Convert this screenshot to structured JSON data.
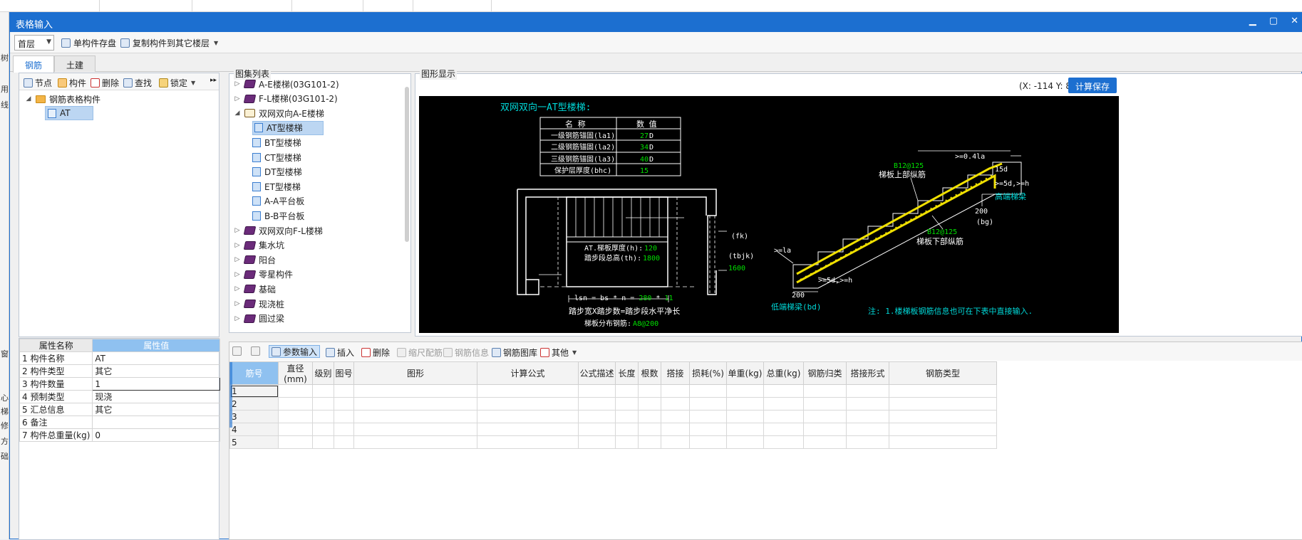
{
  "window": {
    "title": "表格输入"
  },
  "toolbar": {
    "floor": "首层",
    "save_single": "单构件存盘",
    "copy_to_floor": "复制构件到其它楼层"
  },
  "left_edge": [
    "树",
    "用",
    "线",
    "窗",
    "心",
    "梯",
    "修",
    "方",
    "础"
  ],
  "tabs": [
    {
      "label": "钢筋",
      "active": true
    },
    {
      "label": "土建",
      "active": false
    }
  ],
  "left_panel": {
    "tools": [
      "节点",
      "构件",
      "删除",
      "查找",
      "锁定"
    ],
    "tree_root": "钢筋表格构件",
    "tree_child": "AT"
  },
  "properties": {
    "header_name": "属性名称",
    "header_value": "属性值",
    "rows": [
      {
        "no": "1",
        "name": "构件名称",
        "value": "AT"
      },
      {
        "no": "2",
        "name": "构件类型",
        "value": "其它"
      },
      {
        "no": "3",
        "name": "构件数量",
        "value": "1"
      },
      {
        "no": "4",
        "name": "预制类型",
        "value": "现浇"
      },
      {
        "no": "5",
        "name": "汇总信息",
        "value": "其它"
      },
      {
        "no": "6",
        "name": "备注",
        "value": ""
      },
      {
        "no": "7",
        "name": "构件总重量(kg)",
        "value": "0"
      }
    ]
  },
  "atlas": {
    "title": "图集列表",
    "items": [
      {
        "label": "A-E楼梯(03G101-2)",
        "level": 0,
        "icon": "book-icon",
        "exp": "▷"
      },
      {
        "label": "F-L楼梯(03G101-2)",
        "level": 0,
        "icon": "book-icon",
        "exp": "▷"
      },
      {
        "label": "双网双向A-E楼梯",
        "level": 0,
        "icon": "book-open-icon",
        "exp": "◢"
      },
      {
        "label": "AT型楼梯",
        "level": 1,
        "icon": "page-icon",
        "exp": "",
        "selected": true
      },
      {
        "label": "BT型楼梯",
        "level": 1,
        "icon": "page-icon",
        "exp": ""
      },
      {
        "label": "CT型楼梯",
        "level": 1,
        "icon": "page-icon",
        "exp": ""
      },
      {
        "label": "DT型楼梯",
        "level": 1,
        "icon": "page-icon",
        "exp": ""
      },
      {
        "label": "ET型楼梯",
        "level": 1,
        "icon": "page-icon",
        "exp": ""
      },
      {
        "label": "A-A平台板",
        "level": 1,
        "icon": "page-icon",
        "exp": ""
      },
      {
        "label": "B-B平台板",
        "level": 1,
        "icon": "page-icon",
        "exp": ""
      },
      {
        "label": "双网双向F-L楼梯",
        "level": 0,
        "icon": "book-icon",
        "exp": "▷"
      },
      {
        "label": "集水坑",
        "level": 0,
        "icon": "book-icon",
        "exp": "▷"
      },
      {
        "label": "阳台",
        "level": 0,
        "icon": "book-icon",
        "exp": "▷"
      },
      {
        "label": "零星构件",
        "level": 0,
        "icon": "book-icon",
        "exp": "▷"
      },
      {
        "label": "基础",
        "level": 0,
        "icon": "book-icon",
        "exp": "▷"
      },
      {
        "label": "现浇桩",
        "level": 0,
        "icon": "book-icon",
        "exp": "▷"
      },
      {
        "label": "圆过梁",
        "level": 0,
        "icon": "book-icon",
        "exp": "▷"
      }
    ]
  },
  "drawing": {
    "title": "图形显示",
    "coords": "(X: -114 Y: 809)",
    "save_button": "计算保存",
    "heading": "双网双向一AT型楼梯:",
    "table_head": [
      "名 称",
      "数 值"
    ],
    "table_rows": [
      {
        "name": "一级钢筋锚固(la1)",
        "value": "27",
        "unit": "D"
      },
      {
        "name": "二级钢筋锚固(la2)",
        "value": "34",
        "unit": "D"
      },
      {
        "name": "三级钢筋锚固(la3)",
        "value": "40",
        "unit": "D"
      },
      {
        "name": "保护层厚度(bhc)",
        "value": "15",
        "unit": ""
      }
    ],
    "plan_thk_label": "AT.梯板厚度(h):",
    "plan_thk_value": "120",
    "plan_h_label": "踏步段总高(th):",
    "plan_h_value": "1800",
    "fk": "(fk)",
    "tbjk": "(tbjk)",
    "tbjk_value": "1600",
    "lsn_prefix": "lsn = bs * n = ",
    "lsn_bs": "280",
    "lsn_star": " * ",
    "lsn_n": "11",
    "formula_text": "踏步宽X踏步数=踏步段水平净长",
    "dist_label": "梯板分布钢筋:",
    "dist_value": "A8@200",
    "upper_bar": "B12@125",
    "upper_label": "梯板上部纵筋",
    "lower_bar": "B12@125",
    "lower_label": "梯板下部纵筋",
    "high_beam": "高端梯梁",
    "low_beam": "低端梯梁(bd)",
    "dim_04la": ">=0.4la",
    "dim_15d": "15d",
    "dim_5d_top": ">=5d,>=h",
    "dim_5d_bottom": ">=5d,>=h",
    "dim_la": ">=la",
    "dim_200_top": "200",
    "dim_bg": "(bg)",
    "dim_200_bottom": "200",
    "note": "注: 1.楼梯板钢筋信息也可在下表中直接输入."
  },
  "grid_tools": [
    {
      "label": "参数输入",
      "active": true,
      "icon": "param-icon"
    },
    {
      "label": "插入",
      "icon": "insert-icon"
    },
    {
      "label": "删除",
      "icon": "delete-icon"
    },
    {
      "label": "缩尺配筋",
      "disabled": true,
      "icon": "scale-icon"
    },
    {
      "label": "钢筋信息",
      "disabled": true,
      "icon": "info-icon"
    },
    {
      "label": "钢筋图库",
      "icon": "library-icon"
    },
    {
      "label": "其他",
      "icon": "other-icon"
    }
  ],
  "grid": {
    "columns": [
      "筋号",
      "直径(mm)",
      "级别",
      "图号",
      "图形",
      "计算公式",
      "公式描述",
      "长度",
      "根数",
      "搭接",
      "损耗(%)",
      "单重(kg)",
      "总重(kg)",
      "钢筋归类",
      "搭接形式",
      "钢筋类型"
    ],
    "rows": [
      "1",
      "2",
      "3",
      "4",
      "5"
    ]
  },
  "colors": {
    "title_blue": "#1c6fd0",
    "drawing_bg": "#000000",
    "drawing_green": "#00e000",
    "drawing_cyan": "#00d8d8",
    "rebar_yellow": "#f0e000"
  }
}
